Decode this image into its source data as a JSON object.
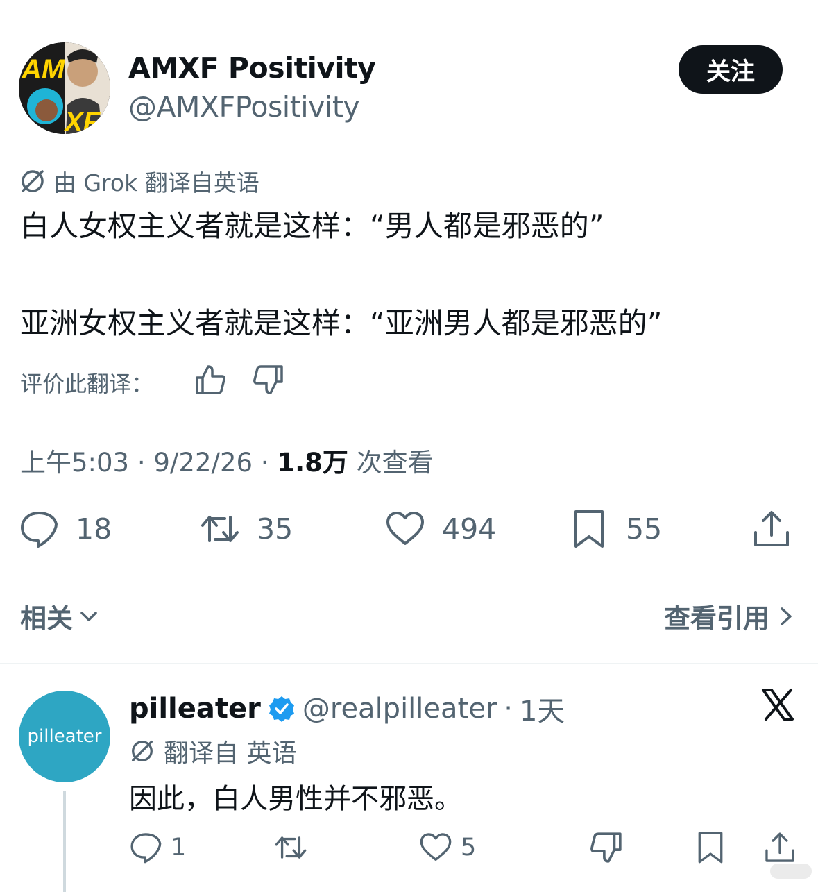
{
  "main_tweet": {
    "display_name": "AMXF Positivity",
    "handle": "@AMXFPositivity",
    "follow_label": "关注",
    "translated_note": "由 Grok 翻译自英语",
    "text_line1": "白人女权主义者就是这样：“男人都是邪恶的”",
    "text_line2": "亚洲女权主义者就是这样：“亚洲男人都是邪恶的”",
    "rate_label": "评价此翻译：",
    "time": "上午5:03",
    "date": "9/22/26",
    "views_count": "1.8万",
    "views_label": "次查看",
    "replies": "18",
    "retweets": "35",
    "likes": "494",
    "bookmarks": "55",
    "related_label": "相关",
    "view_quotes_label": "查看引用"
  },
  "reply": {
    "avatar_text": "pilleater",
    "display_name": "pilleater",
    "handle": "@realpilleater",
    "time": "1天",
    "translated_note": "翻译自 英语",
    "text": "因此，白人男性并不邪恶。",
    "replies": "1",
    "likes": "5"
  },
  "colors": {
    "text": "#0f1419",
    "secondary": "#536471",
    "verified": "#1d9bf0",
    "reply_avatar": "#2ea6c3"
  }
}
